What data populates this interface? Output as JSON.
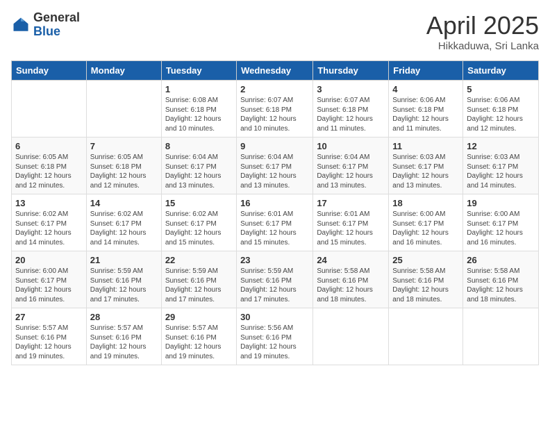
{
  "logo": {
    "general": "General",
    "blue": "Blue"
  },
  "title": "April 2025",
  "subtitle": "Hikkaduwa, Sri Lanka",
  "days_of_week": [
    "Sunday",
    "Monday",
    "Tuesday",
    "Wednesday",
    "Thursday",
    "Friday",
    "Saturday"
  ],
  "weeks": [
    [
      {
        "day": "",
        "info": ""
      },
      {
        "day": "",
        "info": ""
      },
      {
        "day": "1",
        "info": "Sunrise: 6:08 AM\nSunset: 6:18 PM\nDaylight: 12 hours and 10 minutes."
      },
      {
        "day": "2",
        "info": "Sunrise: 6:07 AM\nSunset: 6:18 PM\nDaylight: 12 hours and 10 minutes."
      },
      {
        "day": "3",
        "info": "Sunrise: 6:07 AM\nSunset: 6:18 PM\nDaylight: 12 hours and 11 minutes."
      },
      {
        "day": "4",
        "info": "Sunrise: 6:06 AM\nSunset: 6:18 PM\nDaylight: 12 hours and 11 minutes."
      },
      {
        "day": "5",
        "info": "Sunrise: 6:06 AM\nSunset: 6:18 PM\nDaylight: 12 hours and 12 minutes."
      }
    ],
    [
      {
        "day": "6",
        "info": "Sunrise: 6:05 AM\nSunset: 6:18 PM\nDaylight: 12 hours and 12 minutes."
      },
      {
        "day": "7",
        "info": "Sunrise: 6:05 AM\nSunset: 6:18 PM\nDaylight: 12 hours and 12 minutes."
      },
      {
        "day": "8",
        "info": "Sunrise: 6:04 AM\nSunset: 6:17 PM\nDaylight: 12 hours and 13 minutes."
      },
      {
        "day": "9",
        "info": "Sunrise: 6:04 AM\nSunset: 6:17 PM\nDaylight: 12 hours and 13 minutes."
      },
      {
        "day": "10",
        "info": "Sunrise: 6:04 AM\nSunset: 6:17 PM\nDaylight: 12 hours and 13 minutes."
      },
      {
        "day": "11",
        "info": "Sunrise: 6:03 AM\nSunset: 6:17 PM\nDaylight: 12 hours and 13 minutes."
      },
      {
        "day": "12",
        "info": "Sunrise: 6:03 AM\nSunset: 6:17 PM\nDaylight: 12 hours and 14 minutes."
      }
    ],
    [
      {
        "day": "13",
        "info": "Sunrise: 6:02 AM\nSunset: 6:17 PM\nDaylight: 12 hours and 14 minutes."
      },
      {
        "day": "14",
        "info": "Sunrise: 6:02 AM\nSunset: 6:17 PM\nDaylight: 12 hours and 14 minutes."
      },
      {
        "day": "15",
        "info": "Sunrise: 6:02 AM\nSunset: 6:17 PM\nDaylight: 12 hours and 15 minutes."
      },
      {
        "day": "16",
        "info": "Sunrise: 6:01 AM\nSunset: 6:17 PM\nDaylight: 12 hours and 15 minutes."
      },
      {
        "day": "17",
        "info": "Sunrise: 6:01 AM\nSunset: 6:17 PM\nDaylight: 12 hours and 15 minutes."
      },
      {
        "day": "18",
        "info": "Sunrise: 6:00 AM\nSunset: 6:17 PM\nDaylight: 12 hours and 16 minutes."
      },
      {
        "day": "19",
        "info": "Sunrise: 6:00 AM\nSunset: 6:17 PM\nDaylight: 12 hours and 16 minutes."
      }
    ],
    [
      {
        "day": "20",
        "info": "Sunrise: 6:00 AM\nSunset: 6:17 PM\nDaylight: 12 hours and 16 minutes."
      },
      {
        "day": "21",
        "info": "Sunrise: 5:59 AM\nSunset: 6:16 PM\nDaylight: 12 hours and 17 minutes."
      },
      {
        "day": "22",
        "info": "Sunrise: 5:59 AM\nSunset: 6:16 PM\nDaylight: 12 hours and 17 minutes."
      },
      {
        "day": "23",
        "info": "Sunrise: 5:59 AM\nSunset: 6:16 PM\nDaylight: 12 hours and 17 minutes."
      },
      {
        "day": "24",
        "info": "Sunrise: 5:58 AM\nSunset: 6:16 PM\nDaylight: 12 hours and 18 minutes."
      },
      {
        "day": "25",
        "info": "Sunrise: 5:58 AM\nSunset: 6:16 PM\nDaylight: 12 hours and 18 minutes."
      },
      {
        "day": "26",
        "info": "Sunrise: 5:58 AM\nSunset: 6:16 PM\nDaylight: 12 hours and 18 minutes."
      }
    ],
    [
      {
        "day": "27",
        "info": "Sunrise: 5:57 AM\nSunset: 6:16 PM\nDaylight: 12 hours and 19 minutes."
      },
      {
        "day": "28",
        "info": "Sunrise: 5:57 AM\nSunset: 6:16 PM\nDaylight: 12 hours and 19 minutes."
      },
      {
        "day": "29",
        "info": "Sunrise: 5:57 AM\nSunset: 6:16 PM\nDaylight: 12 hours and 19 minutes."
      },
      {
        "day": "30",
        "info": "Sunrise: 5:56 AM\nSunset: 6:16 PM\nDaylight: 12 hours and 19 minutes."
      },
      {
        "day": "",
        "info": ""
      },
      {
        "day": "",
        "info": ""
      },
      {
        "day": "",
        "info": ""
      }
    ]
  ]
}
